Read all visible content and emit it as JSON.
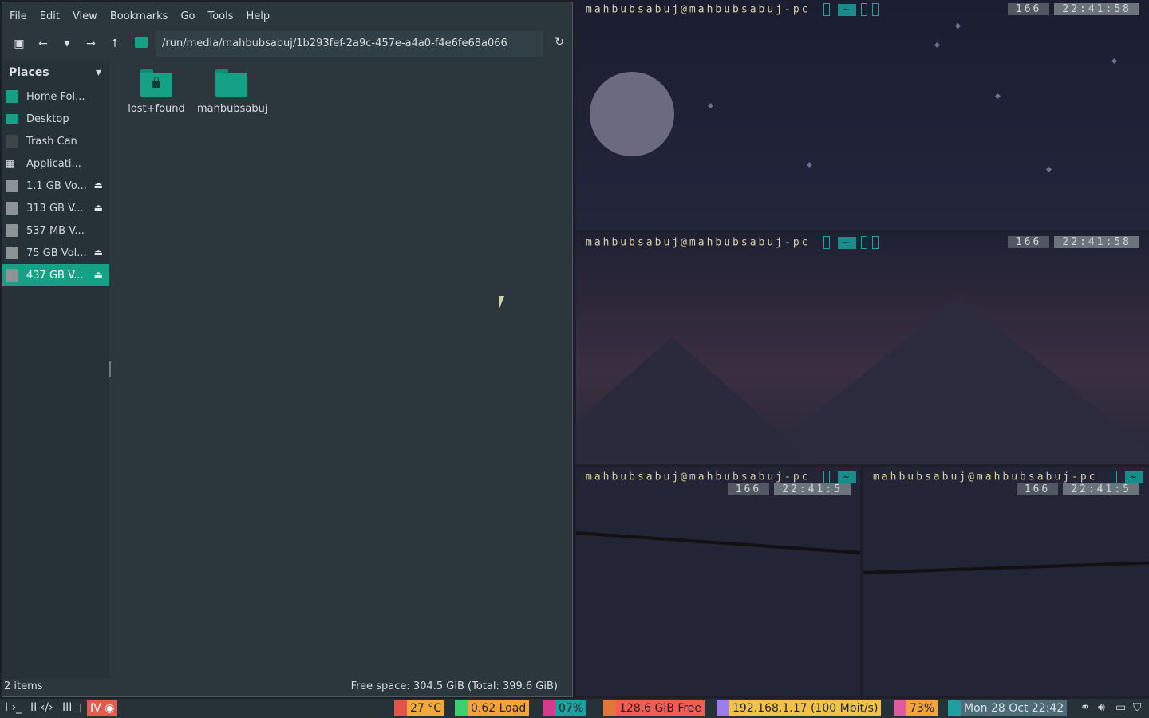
{
  "file_manager": {
    "menu": [
      "File",
      "Edit",
      "View",
      "Bookmarks",
      "Go",
      "Tools",
      "Help"
    ],
    "path": "/run/media/mahbubsabuj/1b293fef-2a9c-457e-a4a0-f4e6fe68a066",
    "places_header": "Places",
    "sidebar": [
      {
        "label": "Home Fol...",
        "icon": "home-icon",
        "eject": false,
        "selected": false
      },
      {
        "label": "Desktop",
        "icon": "desktop-icon",
        "eject": false,
        "selected": false
      },
      {
        "label": "Trash Can",
        "icon": "trash-icon",
        "eject": false,
        "selected": false
      },
      {
        "label": "Applicati...",
        "icon": "apps-icon",
        "eject": false,
        "selected": false
      },
      {
        "label": "1.1 GB Vo...",
        "icon": "drive-icon",
        "eject": true,
        "selected": false
      },
      {
        "label": "313 GB V...",
        "icon": "drive-icon",
        "eject": true,
        "selected": false
      },
      {
        "label": "537 MB V...",
        "icon": "drive-icon",
        "eject": false,
        "selected": false
      },
      {
        "label": "75 GB Vol...",
        "icon": "drive-icon",
        "eject": true,
        "selected": false
      },
      {
        "label": "437 GB V...",
        "icon": "drive-icon",
        "eject": true,
        "selected": true
      }
    ],
    "files": [
      "lost+found",
      "mahbubsabuj"
    ],
    "status_left": "2 items",
    "status_right": "Free space: 304.5 GiB (Total: 399.6 GiB)"
  },
  "terminals": {
    "prompt": "mahbubsabuj@mahbubsabuj-pc",
    "tilde": "~",
    "count": "166",
    "clock_full": "22:41:58",
    "clock_short": "22:41:5"
  },
  "panel": {
    "workspace": "IV",
    "temp": "27 °C",
    "load": "0.62 Load",
    "cpu": "07%",
    "disk": "128.6 GiB Free",
    "network": "192.168.1.17 (100 Mbit/s)",
    "battery": "73%",
    "datetime": "Mon 28 Oct 22:42",
    "colors": {
      "temp": "#f2a93b",
      "load": "#f5a23a",
      "cpu": "#1fa0a0",
      "disk": "#f25c54",
      "network": "#f0c24a",
      "battery": "#f5a23a",
      "datetime": "#4e6b78",
      "accent": "#16a085"
    }
  }
}
